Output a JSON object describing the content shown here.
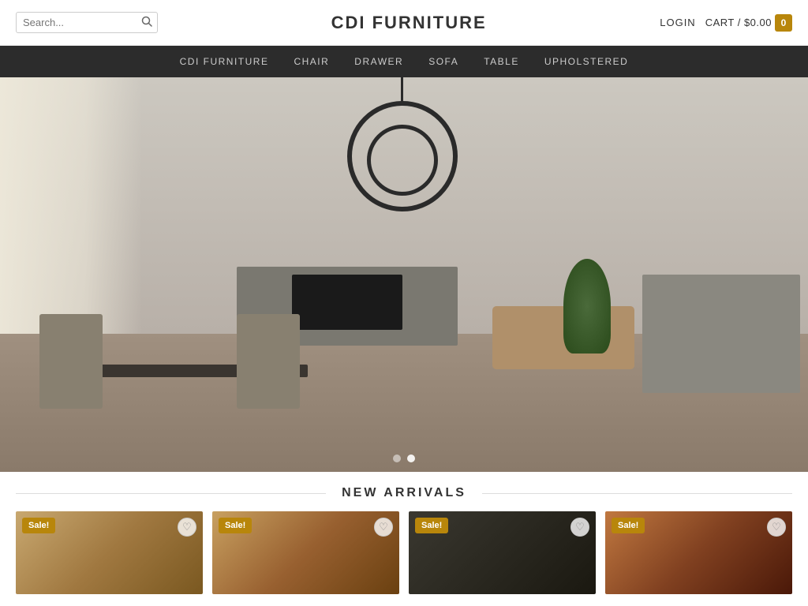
{
  "header": {
    "search_placeholder": "Search...",
    "site_title": "CDI FURNITURE",
    "login_label": "LOGIN",
    "cart_label": "CART / $0.00",
    "cart_count": "0"
  },
  "nav": {
    "items": [
      {
        "id": "cdi-furniture",
        "label": "CDI FURNITURE"
      },
      {
        "id": "chair",
        "label": "CHAIR"
      },
      {
        "id": "drawer",
        "label": "DRAWER"
      },
      {
        "id": "sofa",
        "label": "SOFA"
      },
      {
        "id": "table",
        "label": "TABLE"
      },
      {
        "id": "upholstered",
        "label": "UPHOLSTERED"
      }
    ]
  },
  "hero": {
    "slide_count": 2,
    "active_slide": 1
  },
  "new_arrivals": {
    "section_title": "NEW ARRIVALS",
    "products": [
      {
        "id": "p1",
        "sale": true,
        "sale_label": "Sale!"
      },
      {
        "id": "p2",
        "sale": true,
        "sale_label": "Sale!"
      },
      {
        "id": "p3",
        "sale": true,
        "sale_label": "Sale!"
      },
      {
        "id": "p4",
        "sale": true,
        "sale_label": "Sale!"
      }
    ]
  }
}
